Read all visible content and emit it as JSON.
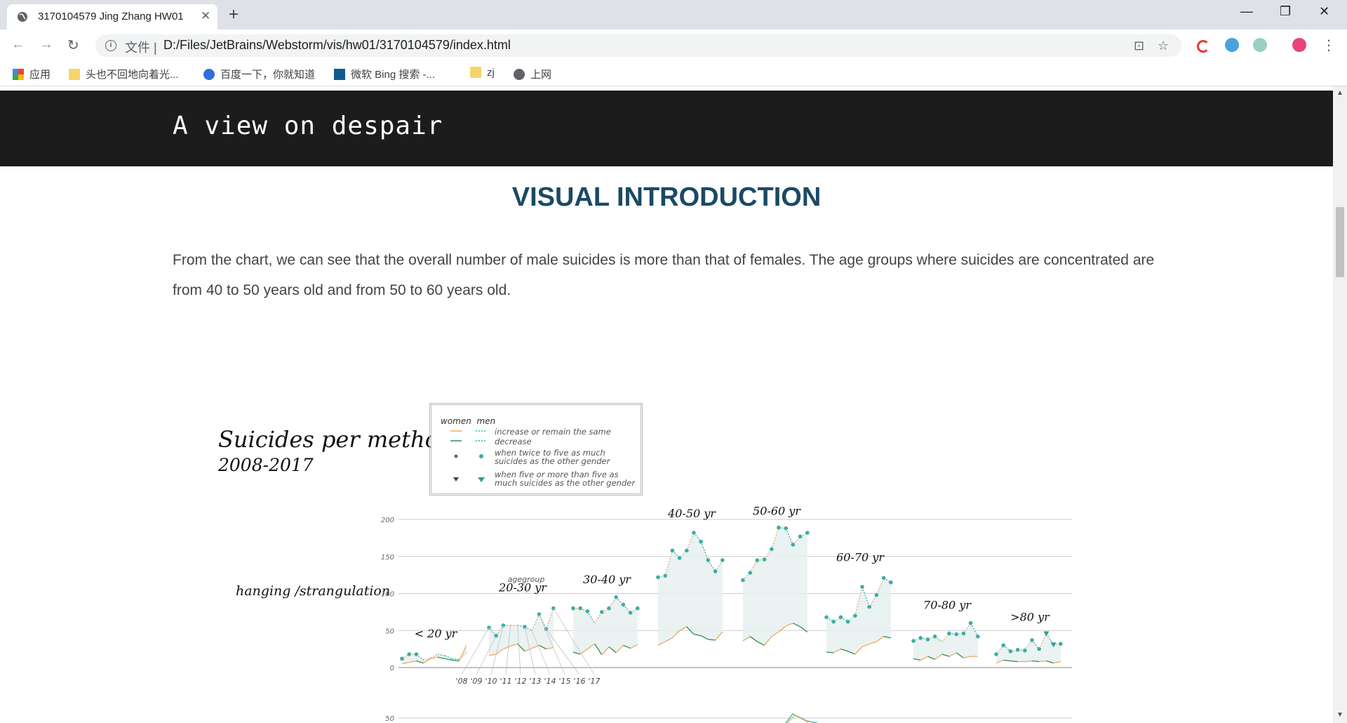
{
  "browser": {
    "tab_title": "3170104579 Jing Zhang HW01",
    "url_prefix": "文件 |",
    "url": "D:/Files/JetBrains/Webstorm/vis/hw01/3170104579/index.html",
    "bookmarks": [
      {
        "label": "应用",
        "icon": "apps-grid-icon"
      },
      {
        "label": "头也不回地向着光...",
        "icon": "folder-icon"
      },
      {
        "label": "百度一下，你就知道",
        "icon": "baidu-paw-icon"
      },
      {
        "label": "微软 Bing 搜索 -...",
        "icon": "bing-icon"
      },
      {
        "label": "zj",
        "icon": "folder-icon"
      },
      {
        "label": "上网",
        "icon": "globe-icon"
      }
    ]
  },
  "page": {
    "hero_title": "A view on despair",
    "section_title": "VISUAL INTRODUCTION",
    "intro": "From the chart, we can see that the overall number of male suicides is more than that of females. The age groups where suicides are concentrated are from 40 to 50 years old and from 50 to 60 years old."
  },
  "viz": {
    "title": "Suicides per method",
    "subtitle": "2008-2017",
    "method": "hanging /strangulation",
    "legend": {
      "col_women": "women",
      "col_men": "men",
      "rows": [
        "increase or remain the same",
        "decrease",
        "when twice to five as much suicides as the other gender",
        "when five or more than five as much suicides as the other gender"
      ]
    },
    "agegroup_label": "agegroup"
  },
  "chart_data": {
    "type": "line",
    "title": "Suicides per method",
    "subtitle": "2008-2017",
    "ylim": [
      0,
      200
    ],
    "yticks": [
      "0",
      "50",
      "100",
      "150",
      "200"
    ],
    "year_ticks": [
      "'08",
      "'09",
      "'10",
      "'11",
      "'12",
      "'13",
      "'14",
      "'15",
      "'16",
      "'17"
    ],
    "colors": {
      "men": "#3aaea6",
      "women_increase": "#f0a860",
      "women_decrease": "#2e8b57",
      "area": "#e6f0f0"
    },
    "groups": [
      {
        "label": "< 20 yr",
        "men": [
          12,
          18,
          18,
          10,
          13,
          18,
          16,
          12,
          11,
          20
        ],
        "women": [
          5,
          7,
          9,
          6,
          12,
          14,
          12,
          10,
          9,
          30
        ]
      },
      {
        "label": "20-30 yr",
        "men": [
          54,
          43,
          57,
          57,
          57,
          55,
          50,
          72,
          52,
          80
        ],
        "women": [
          16,
          18,
          25,
          29,
          32,
          22,
          26,
          30,
          25,
          27
        ]
      },
      {
        "label": "30-40 yr",
        "men": [
          80,
          80,
          76,
          60,
          75,
          80,
          95,
          85,
          74,
          80
        ],
        "women": [
          21,
          18,
          25,
          32,
          17,
          28,
          20,
          30,
          26,
          31
        ]
      },
      {
        "label": "40-50 yr",
        "men": [
          122,
          124,
          158,
          148,
          158,
          182,
          170,
          145,
          130,
          145
        ],
        "women": [
          30,
          35,
          40,
          50,
          55,
          45,
          43,
          38,
          37,
          48
        ]
      },
      {
        "label": "50-60 yr",
        "men": [
          118,
          128,
          145,
          146,
          160,
          189,
          188,
          166,
          177,
          182
        ],
        "women": [
          36,
          42,
          35,
          30,
          42,
          48,
          56,
          60,
          55,
          48
        ]
      },
      {
        "label": "60-70 yr",
        "men": [
          68,
          62,
          68,
          62,
          70,
          109,
          82,
          98,
          121,
          115
        ],
        "women": [
          21,
          20,
          25,
          22,
          18,
          28,
          32,
          35,
          42,
          40
        ]
      },
      {
        "label": "70-80 yr",
        "men": [
          36,
          40,
          38,
          42,
          35,
          46,
          45,
          46,
          60,
          42
        ],
        "women": [
          12,
          10,
          15,
          11,
          18,
          15,
          20,
          13,
          15,
          15
        ]
      },
      {
        "label": ">80 yr",
        "men": [
          18,
          30,
          22,
          24,
          23,
          37,
          25,
          46,
          31,
          32
        ],
        "women": [
          6,
          10,
          9,
          8,
          8,
          9,
          8,
          9,
          6,
          8
        ]
      }
    ],
    "next_panel_ytick": "50"
  }
}
